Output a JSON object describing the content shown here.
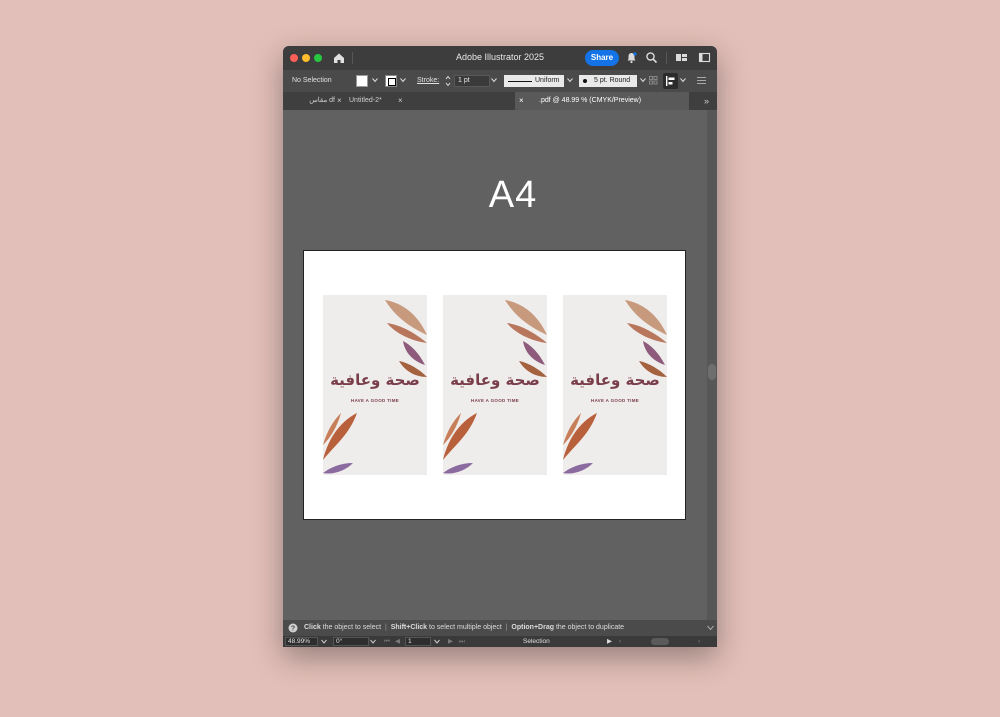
{
  "window": {
    "title": "Adobe Illustrator 2025",
    "share_label": "Share"
  },
  "control_bar": {
    "selection": "No Selection",
    "stroke_label": "Stroke:",
    "stroke_weight": "1 pt",
    "profile": "Uniform",
    "brush": "5 pt. Round"
  },
  "tabs": [
    {
      "label": "مقاس df"
    },
    {
      "label": "Untitled-2*"
    },
    {
      "label": ".pdf @ 48.99 % (CMYK/Preview)"
    }
  ],
  "canvas": {
    "artboard_label": "A4",
    "cards": [
      {
        "arabic": "صحة وعافية",
        "subtitle": "HAVE A GOOD TIME"
      },
      {
        "arabic": "صحة وعافية",
        "subtitle": "HAVE A GOOD TIME"
      },
      {
        "arabic": "صحة وعافية",
        "subtitle": "HAVE A GOOD TIME"
      }
    ]
  },
  "status": {
    "hint_1_key": "Click",
    "hint_1_text": "the object to select",
    "hint_2_key": "Shift+Click",
    "hint_2_text": "to select multiple object",
    "hint_3_key": "Option+Drag",
    "hint_3_text": "the object to duplicate"
  },
  "bottom": {
    "zoom": "48.99%",
    "rotation": "0°",
    "artboard_number": "1",
    "tool": "Selection"
  },
  "colors": {
    "accent": "#1473e6",
    "background": "#e2bfb8",
    "canvas": "#616161",
    "card_text": "#7a3e4b"
  }
}
